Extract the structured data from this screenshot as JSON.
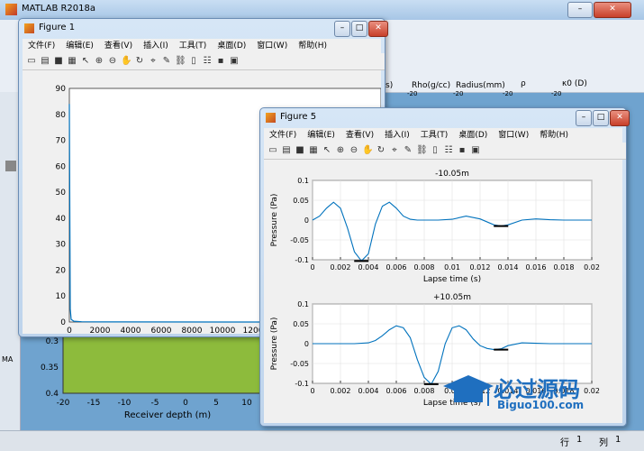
{
  "matlab": {
    "title": "MATLAB R2018a",
    "status": {
      "row_label": "行",
      "row_value": "1",
      "col_label": "列",
      "col_value": "1"
    },
    "ribbon_labels": [
      "Rho(g/cc)",
      "Radius(mm)"
    ],
    "ribbon_ticks": [
      "-20",
      "-20",
      "-20",
      "-20"
    ],
    "ribbon_symbols": [
      "(D)",
      "ρ",
      "κ0 (D)",
      "s)"
    ],
    "left_tab": "MA",
    "background_plot": {
      "yticks": [
        "0.3",
        "0.35",
        "0.4"
      ],
      "xticks": [
        "-20",
        "-15",
        "-10",
        "-5",
        "0",
        "5",
        "10"
      ],
      "xlabel": "Receiver depth (m)",
      "fill_color": "#8dbb3c"
    }
  },
  "figure1": {
    "title": "Figure 1",
    "menu": [
      "文件(F)",
      "编辑(E)",
      "查看(V)",
      "插入(I)",
      "工具(T)",
      "桌面(D)",
      "窗口(W)",
      "帮助(H)"
    ],
    "chart_data": {
      "type": "line",
      "title": "",
      "xlabel": "",
      "ylabel": "",
      "yticks": [
        "0",
        "10",
        "20",
        "30",
        "40",
        "50",
        "60",
        "70",
        "80",
        "90"
      ],
      "xticks": [
        "0",
        "2000",
        "4000",
        "6000",
        "8000",
        "10000",
        "1200"
      ],
      "ylim": [
        0,
        90
      ],
      "xlim": [
        0,
        14000
      ],
      "series": [
        {
          "x": [
            0,
            60,
            120,
            300,
            800,
            2000,
            14000
          ],
          "y": [
            84,
            5,
            1,
            0.3,
            0.1,
            0.05,
            0
          ]
        }
      ]
    }
  },
  "figure5": {
    "title": "Figure 5",
    "menu": [
      "文件(F)",
      "编辑(E)",
      "查看(V)",
      "插入(I)",
      "工具(T)",
      "桌面(D)",
      "窗口(W)",
      "帮助(H)"
    ],
    "chart_data": [
      {
        "type": "line",
        "title": "-10.05m",
        "xlabel": "Lapse time (s)",
        "ylabel": "Pressure (Pa)",
        "xlim": [
          0,
          0.02
        ],
        "ylim": [
          -0.1,
          0.1
        ],
        "xticks": [
          "0",
          "0.002",
          "0.004",
          "0.006",
          "0.008",
          "0.01",
          "0.012",
          "0.014",
          "0.016",
          "0.018",
          "0.02"
        ],
        "yticks": [
          "0.1",
          "0.05",
          "0",
          "-0.05",
          "-0.1"
        ],
        "grid": true,
        "series": [
          {
            "x": [
              0,
              0.0005,
              0.001,
              0.0015,
              0.002,
              0.0025,
              0.003,
              0.0035,
              0.004,
              0.0045,
              0.005,
              0.0055,
              0.006,
              0.0065,
              0.007,
              0.0075,
              0.008,
              0.009,
              0.01,
              0.011,
              0.012,
              0.013,
              0.0135,
              0.014,
              0.015,
              0.016,
              0.017,
              0.018,
              0.019,
              0.02
            ],
            "y": [
              0,
              0.01,
              0.03,
              0.045,
              0.03,
              -0.02,
              -0.08,
              -0.103,
              -0.085,
              -0.01,
              0.035,
              0.045,
              0.03,
              0.01,
              0.002,
              0,
              0,
              0,
              0.002,
              0.01,
              0.003,
              -0.012,
              -0.015,
              -0.012,
              0,
              0.003,
              0.001,
              0,
              0,
              0
            ]
          }
        ],
        "markers": [
          {
            "x": 0.0035,
            "y": -0.103
          },
          {
            "x": 0.0135,
            "y": -0.015
          }
        ]
      },
      {
        "type": "line",
        "title": "+10.05m",
        "xlabel": "Lapse time (s)",
        "ylabel": "Pressure (Pa)",
        "xlim": [
          0,
          0.02
        ],
        "ylim": [
          -0.1,
          0.1
        ],
        "xticks": [
          "0",
          "0.002",
          "0.004",
          "0.006",
          "0.008",
          "0.01",
          "0.012",
          "0.014",
          "0.016",
          "0.018",
          "0.02"
        ],
        "yticks": [
          "0.1",
          "0.05",
          "0",
          "-0.05",
          "-0.1"
        ],
        "grid": true,
        "series": [
          {
            "x": [
              0,
              0.001,
              0.002,
              0.003,
              0.004,
              0.0045,
              0.005,
              0.0055,
              0.006,
              0.0065,
              0.007,
              0.0075,
              0.008,
              0.0085,
              0.009,
              0.0095,
              0.01,
              0.0105,
              0.011,
              0.0115,
              0.012,
              0.0125,
              0.013,
              0.0135,
              0.014,
              0.015,
              0.016,
              0.017,
              0.018,
              0.02
            ],
            "y": [
              0,
              0,
              0,
              0,
              0.002,
              0.008,
              0.02,
              0.035,
              0.045,
              0.04,
              0.015,
              -0.04,
              -0.085,
              -0.102,
              -0.07,
              0,
              0.04,
              0.045,
              0.035,
              0.012,
              -0.005,
              -0.012,
              -0.015,
              -0.013,
              -0.005,
              0.002,
              0.001,
              0,
              0,
              0
            ]
          }
        ],
        "markers": [
          {
            "x": 0.0085,
            "y": -0.102
          },
          {
            "x": 0.0135,
            "y": -0.015
          }
        ]
      }
    ]
  },
  "watermark": {
    "brand": "必过源码",
    "url": "Biguo100.com"
  }
}
